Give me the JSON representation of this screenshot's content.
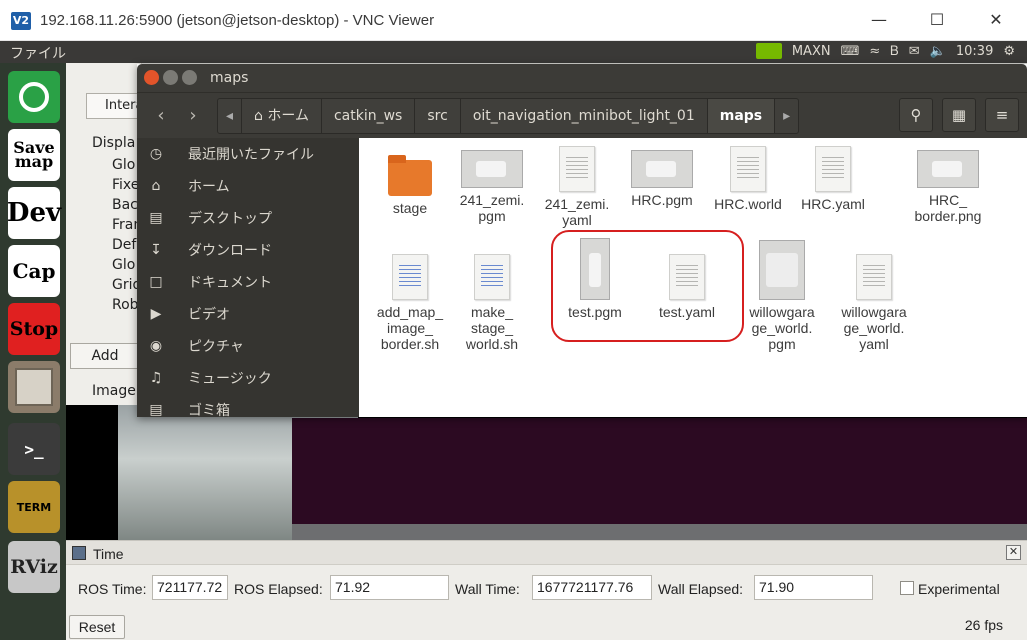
{
  "vnc": {
    "logo": "V2",
    "title": "192.168.11.26:5900 (jetson@jetson-desktop) - VNC Viewer",
    "minimize_icon": "minimize-icon",
    "maximize_icon": "maximize-icon",
    "close_icon": "close-icon"
  },
  "top_panel": {
    "app_menu": "ファイル",
    "power_mode": "MAXN",
    "clock": "10:39"
  },
  "launcher": {
    "items": [
      {
        "icon": "ubuntu-dash-icon"
      },
      {
        "icon": "save-map-icon",
        "text": "Save map"
      },
      {
        "icon": "dev-icon",
        "text": "Dev"
      },
      {
        "icon": "cap-icon",
        "text": "Cap"
      },
      {
        "icon": "stop-icon",
        "text": "Stop"
      },
      {
        "icon": "file-cabinet-icon"
      },
      {
        "icon": "terminal-icon"
      },
      {
        "icon": "xterm-icon",
        "text": "TERM"
      },
      {
        "icon": "rviz-icon",
        "text": "RViz"
      }
    ]
  },
  "rviz": {
    "toolbar_interact": "Intera",
    "displays_label": "Displa",
    "tree": [
      "Glo",
      "Fixe",
      "Bac",
      "Fran",
      "Def",
      "Glo",
      "Grid",
      "Rob"
    ],
    "add_button": "Add",
    "image_label": "Image"
  },
  "files": {
    "window_title": "maps",
    "breadcrumb": [
      "ホーム",
      "catkin_ws",
      "src",
      "oit_navigation_minibot_light_01",
      "maps"
    ],
    "sidebar": [
      {
        "icon": "clock-icon",
        "label": "最近開いたファイル"
      },
      {
        "icon": "home-icon",
        "label": "ホーム"
      },
      {
        "icon": "folder-icon",
        "label": "デスクトップ"
      },
      {
        "icon": "download-icon",
        "label": "ダウンロード"
      },
      {
        "icon": "document-icon",
        "label": "ドキュメント"
      },
      {
        "icon": "video-icon",
        "label": "ビデオ"
      },
      {
        "icon": "camera-icon",
        "label": "ピクチャ"
      },
      {
        "icon": "music-icon",
        "label": "ミュージック"
      },
      {
        "icon": "trash-icon",
        "label": "ゴミ箱"
      }
    ],
    "items": [
      {
        "name": "stage",
        "kind": "folder"
      },
      {
        "name": "241_zemi.\npgm",
        "kind": "pgm"
      },
      {
        "name": "241_zemi.\nyaml",
        "kind": "doc"
      },
      {
        "name": "HRC.pgm",
        "kind": "pgm"
      },
      {
        "name": "HRC.world",
        "kind": "doc"
      },
      {
        "name": "HRC.yaml",
        "kind": "doc"
      },
      {
        "name": "HRC_\nborder.png",
        "kind": "pgm"
      },
      {
        "name": "add_map_\nimage_\nborder.sh",
        "kind": "script"
      },
      {
        "name": "make_\nstage_\nworld.sh",
        "kind": "script"
      },
      {
        "name": "test.pgm",
        "kind": "pgm-tall"
      },
      {
        "name": "test.yaml",
        "kind": "doc"
      },
      {
        "name": "willowgara\nge_world.\npgm",
        "kind": "pgm-square"
      },
      {
        "name": "willowgara\nge_world.\nyaml",
        "kind": "doc"
      }
    ]
  },
  "time_panel": {
    "title": "Time",
    "ros_time_label": "ROS Time:",
    "ros_time": "721177.72",
    "ros_elapsed_label": "ROS Elapsed:",
    "ros_elapsed": "71.92",
    "wall_time_label": "Wall Time:",
    "wall_time": "1677721177.76",
    "wall_elapsed_label": "Wall Elapsed:",
    "wall_elapsed": "71.90",
    "experimental_label": "Experimental",
    "reset_button": "Reset",
    "fps": "26 fps"
  },
  "colors": {
    "accent": "#e7792b",
    "highlight": "#d61f1f",
    "panel": "#3c3b37"
  }
}
